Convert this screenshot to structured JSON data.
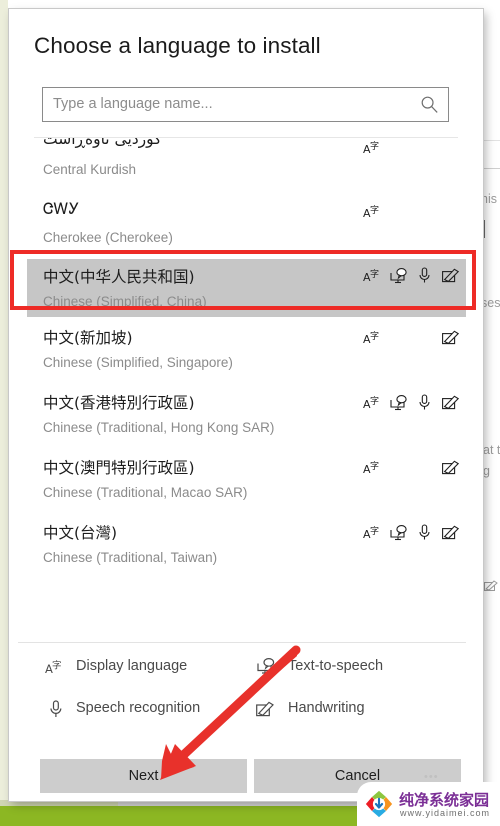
{
  "dialog": {
    "title": "Choose a language to install",
    "search": {
      "placeholder": "Type a language name...",
      "value": "",
      "icon": "search-icon"
    },
    "languages": [
      {
        "native": "كوردیی ناوەڕاست",
        "english": "Central Kurdish",
        "features": [
          "display-language"
        ],
        "selected": false,
        "clipped_top": true
      },
      {
        "native": "ᏣᎳᎩ",
        "english": "Cherokee (Cherokee)",
        "features": [
          "display-language"
        ],
        "selected": false
      },
      {
        "native": "中文(中华人民共和国)",
        "english": "Chinese (Simplified, China)",
        "features": [
          "display-language",
          "text-to-speech",
          "speech-recognition",
          "handwriting"
        ],
        "selected": true
      },
      {
        "native": "中文(新加坡)",
        "english": "Chinese (Simplified, Singapore)",
        "features": [
          "display-language",
          "handwriting"
        ],
        "selected": false
      },
      {
        "native": "中文(香港特別行政區)",
        "english": "Chinese (Traditional, Hong Kong SAR)",
        "features": [
          "display-language",
          "text-to-speech",
          "speech-recognition",
          "handwriting"
        ],
        "selected": false
      },
      {
        "native": "中文(澳門特別行政區)",
        "english": "Chinese (Traditional, Macao SAR)",
        "features": [
          "display-language",
          "handwriting"
        ],
        "selected": false
      },
      {
        "native": "中文(台灣)",
        "english": "Chinese (Traditional, Taiwan)",
        "features": [
          "display-language",
          "text-to-speech",
          "speech-recognition",
          "handwriting"
        ],
        "selected": false
      }
    ],
    "legend": [
      {
        "icon": "display-language-icon",
        "label": "Display language"
      },
      {
        "icon": "text-to-speech-icon",
        "label": "Text-to-speech"
      },
      {
        "icon": "speech-recognition-icon",
        "label": "Speech recognition"
      },
      {
        "icon": "handwriting-icon",
        "label": "Handwriting"
      }
    ],
    "buttons": {
      "next": "Next",
      "cancel": "Cancel",
      "overflow": "•••"
    }
  },
  "background": {
    "fragments": [
      {
        "text": "his"
      },
      {
        "text": "ses"
      },
      {
        "text": "at t"
      },
      {
        "text": "g"
      }
    ]
  },
  "annotations": {
    "highlight_color": "#ee2b26",
    "arrow_color": "#e8312b",
    "highlight_target": "中文(中华人民共和国)",
    "arrow_target": "Next"
  },
  "watermark": {
    "cn": "纯净系统家园",
    "url": "www.yidaimei.com"
  },
  "colors": {
    "selection": "#c6c6c6",
    "button": "#cdcdcd",
    "accent_green": "#8cb723"
  }
}
